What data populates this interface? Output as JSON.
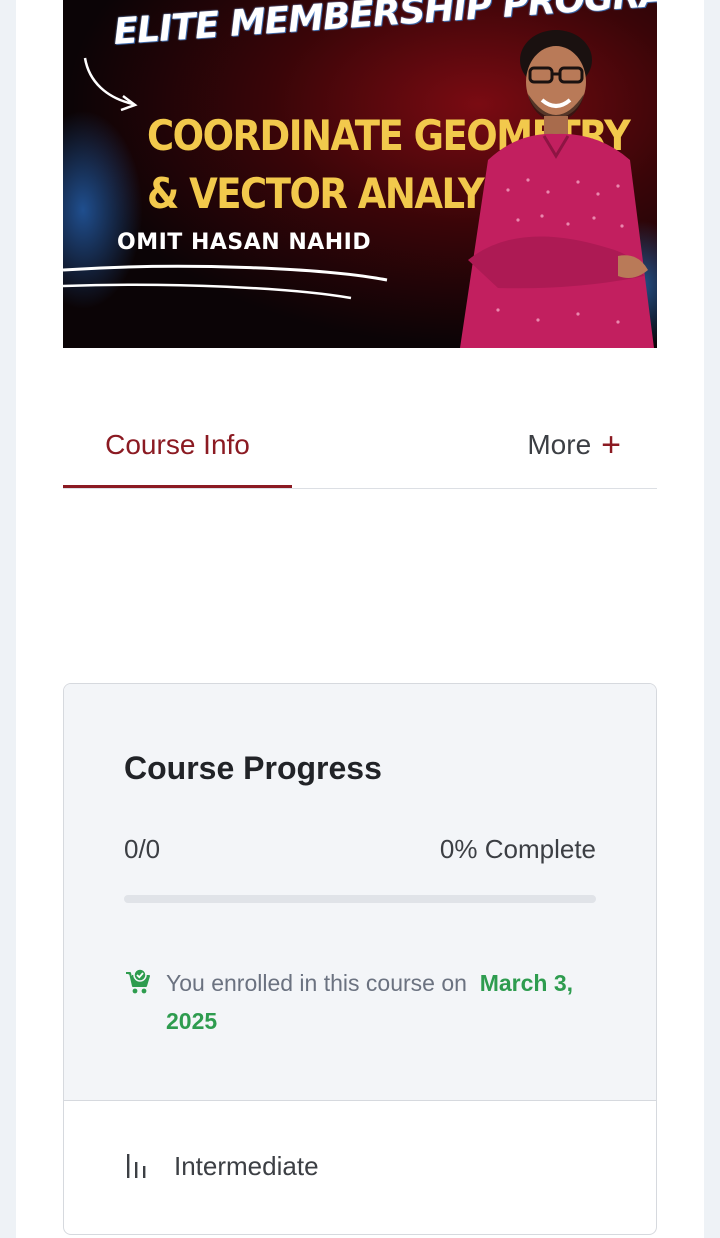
{
  "banner": {
    "heading": "ELITE MEMBERSHIP PROGRAM",
    "line1": "COORDINATE GEOMETRY",
    "line2": "& VECTOR ANALYSIS",
    "author": "OMIT HASAN NAHID"
  },
  "tabs": {
    "info_label": "Course Info",
    "more_label": "More",
    "more_icon": "plus-icon"
  },
  "progress": {
    "title": "Course Progress",
    "count": "0/0",
    "percent_label": "0% Complete",
    "percent_value": 0,
    "enroll_text": "You enrolled in this course on",
    "enroll_date_part1": "March 3,",
    "enroll_date_part2": "2025",
    "enroll_icon": "cart-check-icon"
  },
  "level": {
    "icon": "level-bars-icon",
    "label": "Intermediate"
  },
  "colors": {
    "accent": "#8b1a22",
    "success": "#2e9c4f",
    "banner_yellow": "#f2c94c"
  }
}
